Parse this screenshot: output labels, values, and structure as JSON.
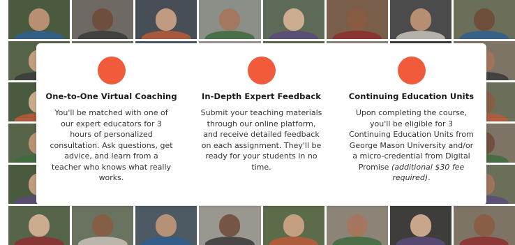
{
  "features": [
    {
      "icon": "orange-circle-icon",
      "title": "One-to-One Virtual Coaching",
      "description": "You'll be matched with one of our expert educators for 3 hours of personalized consultation. Ask questions, get advice, and learn from a teacher who knows what really works."
    },
    {
      "icon": "orange-circle-icon",
      "title": "In-Depth Expert Feedback",
      "description": "Submit your teaching materials through our online platform, and receive detailed feedback on each assignment. They'll be ready for your students in no time."
    },
    {
      "icon": "orange-circle-icon",
      "title": "Continuing Education Units",
      "description": "Upon completing the course, you'll be eligible for 3 Continuing Education Units from George Mason University and/or a micro-credential from Digital Promise ",
      "description_note": "(additional $30 fee required)",
      "description_end": "."
    }
  ],
  "colors": {
    "accent": "#f15a3b"
  }
}
